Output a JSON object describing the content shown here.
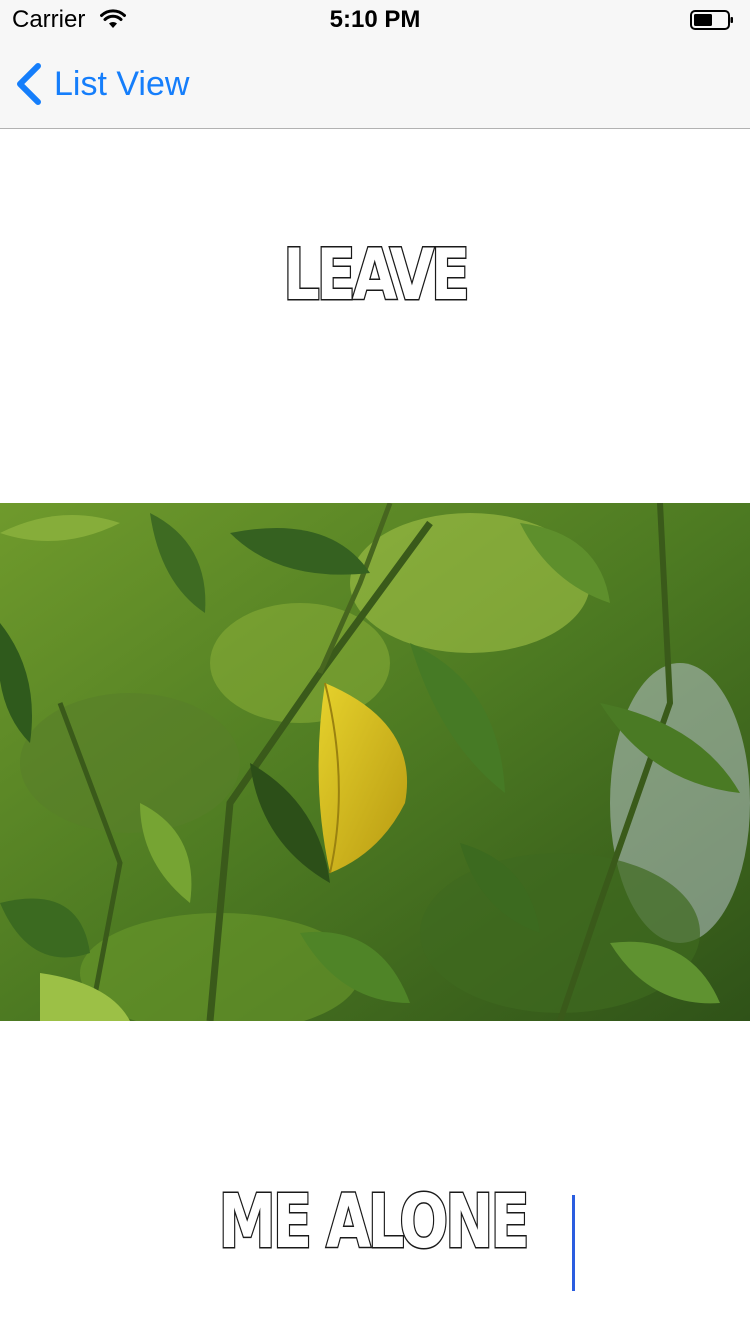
{
  "status_bar": {
    "carrier": "Carrier",
    "time": "5:10 PM"
  },
  "nav": {
    "back_label": "List View"
  },
  "meme": {
    "top_text": "LEAVE",
    "bottom_text": "ME ALONE"
  },
  "icons": {
    "wifi": "wifi-icon",
    "battery": "battery-icon",
    "back": "chevron-left-icon"
  },
  "colors": {
    "accent": "#157efb",
    "cursor": "#2a5de0",
    "bar_background": "#f7f7f7"
  }
}
